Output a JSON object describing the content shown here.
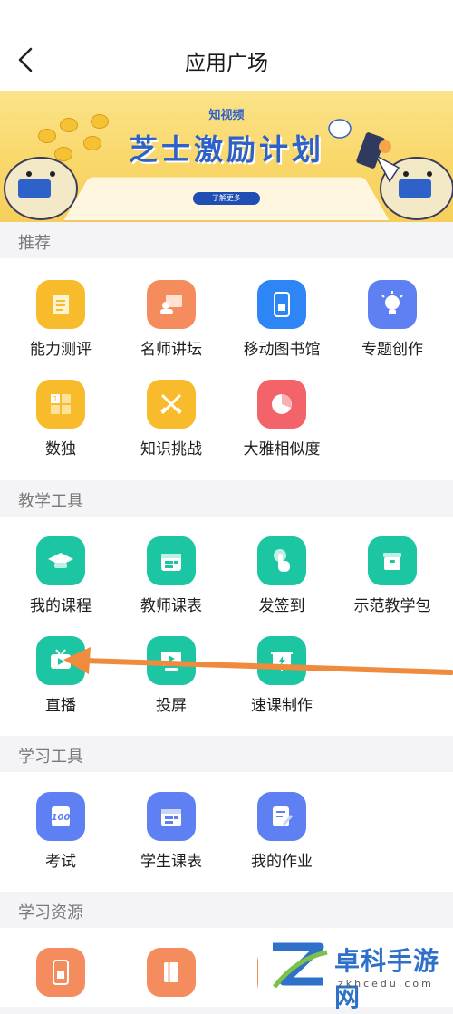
{
  "header": {
    "title": "应用广场"
  },
  "banner": {
    "brand": "知视频",
    "headline": "芝士激励计划",
    "cta": "了解更多"
  },
  "sections": {
    "recommend": {
      "title": "推荐",
      "items": [
        {
          "label": "能力测评",
          "icon": "document-icon",
          "color": "#f8bb2c"
        },
        {
          "label": "名师讲坛",
          "icon": "lecturer-icon",
          "color": "#f58c5e"
        },
        {
          "label": "移动图书馆",
          "icon": "mobile-library-icon",
          "color": "#2e86f6"
        },
        {
          "label": "专题创作",
          "icon": "lightbulb-icon",
          "color": "#5f80f2"
        },
        {
          "label": "数独",
          "icon": "sudoku-grid-icon",
          "color": "#f8bb2c"
        },
        {
          "label": "知识挑战",
          "icon": "crossed-swords-icon",
          "color": "#f8bb2c"
        },
        {
          "label": "大雅相似度",
          "icon": "pie-chart-icon",
          "color": "#f2636a"
        }
      ]
    },
    "teaching_tools": {
      "title": "教学工具",
      "items": [
        {
          "label": "我的课程",
          "icon": "graduation-cap-icon",
          "color": "#1cc6a2"
        },
        {
          "label": "教师课表",
          "icon": "calendar-icon",
          "color": "#1cc6a2"
        },
        {
          "label": "发签到",
          "icon": "tap-hand-icon",
          "color": "#1cc6a2"
        },
        {
          "label": "示范教学包",
          "icon": "package-icon",
          "color": "#1cc6a2"
        },
        {
          "label": "直播",
          "icon": "tv-live-icon",
          "color": "#1cc6a2"
        },
        {
          "label": "投屏",
          "icon": "screen-cast-icon",
          "color": "#1cc6a2"
        },
        {
          "label": "速课制作",
          "icon": "presentation-icon",
          "color": "#1cc6a2"
        }
      ]
    },
    "learning_tools": {
      "title": "学习工具",
      "items": [
        {
          "label": "考试",
          "icon": "exam-score-icon",
          "color": "#5f80f2"
        },
        {
          "label": "学生课表",
          "icon": "calendar-icon",
          "color": "#5f80f2"
        },
        {
          "label": "我的作业",
          "icon": "homework-edit-icon",
          "color": "#5f80f2"
        }
      ]
    },
    "learning_resources": {
      "title": "学习资源"
    }
  },
  "annotation": {
    "color": "#f08a3c",
    "target": "直播"
  },
  "watermark": {
    "title": "卓科手游网",
    "url": "zkhcedu.com"
  }
}
